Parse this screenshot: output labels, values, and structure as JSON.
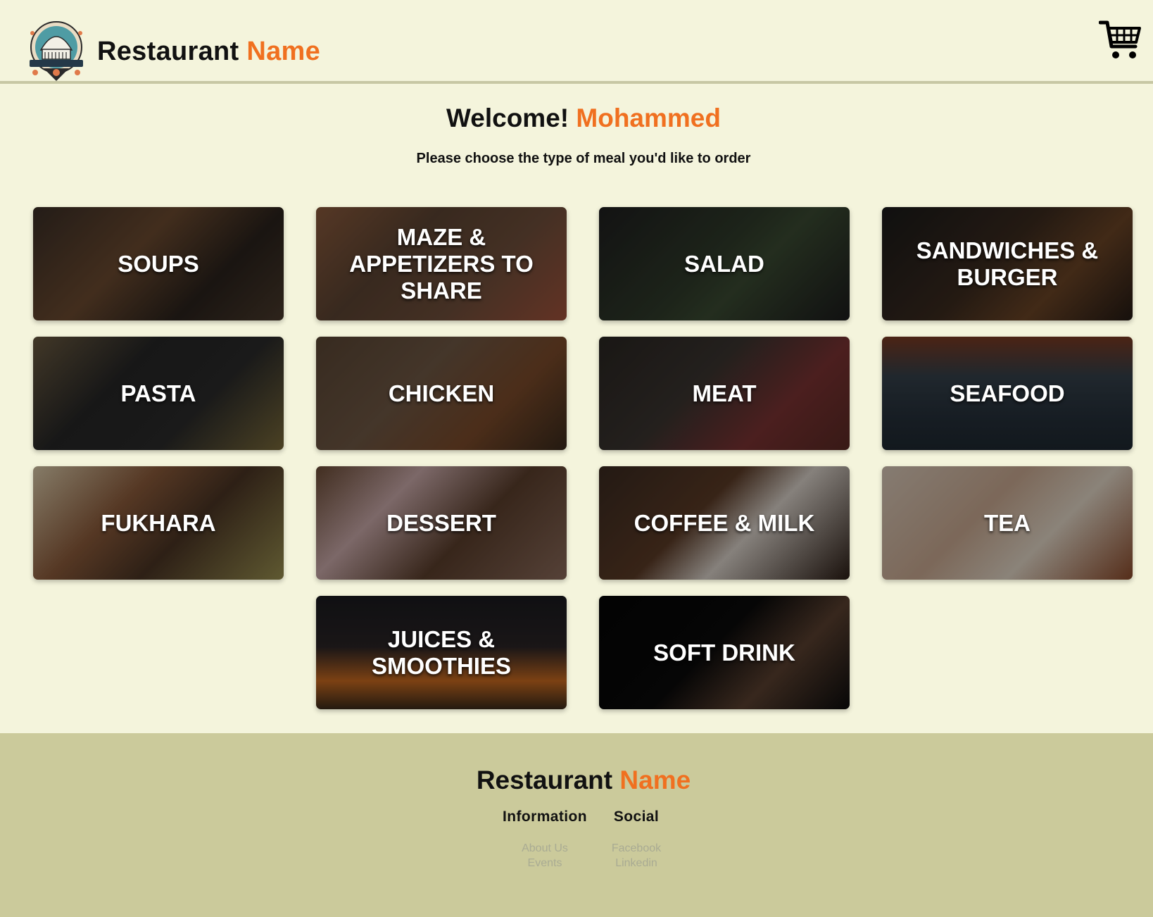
{
  "header": {
    "brand_main": "Restaurant",
    "brand_accent": "Name"
  },
  "welcome": {
    "greeting": "Welcome!",
    "user_name": "Mohammed",
    "subtitle": "Please choose the type of meal you'd like to order"
  },
  "categories": [
    {
      "label": "SOUPS"
    },
    {
      "label": "MAZE & APPETIZERS TO SHARE"
    },
    {
      "label": "SALAD"
    },
    {
      "label": "SANDWICHES & BURGER"
    },
    {
      "label": "PASTA"
    },
    {
      "label": "CHICKEN"
    },
    {
      "label": "MEAT"
    },
    {
      "label": "SEAFOOD"
    },
    {
      "label": "FUKHARA"
    },
    {
      "label": "DESSERT"
    },
    {
      "label": "COFFEE & MILK"
    },
    {
      "label": "TEA"
    },
    {
      "label": "JUICES & SMOOTHIES"
    },
    {
      "label": "SOFT DRINK"
    }
  ],
  "footer": {
    "brand_main": "Restaurant",
    "brand_accent": "Name",
    "information": {
      "heading": "Information",
      "links": [
        "About Us",
        "Events"
      ]
    },
    "social": {
      "heading": "Social",
      "links": [
        "Facebook",
        "Linkedin"
      ]
    }
  },
  "icons": {
    "logo": "restaurant-logo",
    "cart": "shopping-cart-icon"
  },
  "colors": {
    "accent": "#f07020",
    "background": "#f4f4dc",
    "footer_bg": "#cbca9b"
  }
}
